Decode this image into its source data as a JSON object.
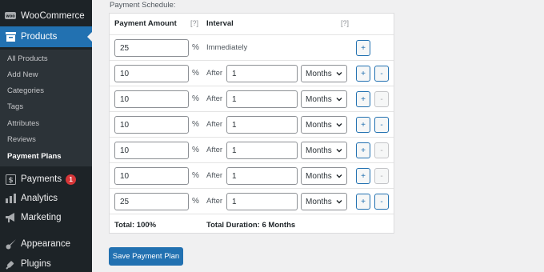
{
  "sidebar": {
    "woocommerce": "WooCommerce",
    "products": "Products",
    "submenu": [
      "All Products",
      "Add New",
      "Categories",
      "Tags",
      "Attributes",
      "Reviews",
      "Payment Plans"
    ],
    "payments": "Payments",
    "payments_badge": "1",
    "analytics": "Analytics",
    "marketing": "Marketing",
    "appearance": "Appearance",
    "plugins": "Plugins"
  },
  "schedule": {
    "caption": "Payment Schedule:",
    "col_amount": "Payment Amount",
    "col_interval": "Interval",
    "help": "[?]",
    "percent": "%",
    "immediately": "Immediately",
    "after": "After",
    "add": "+",
    "remove": "-",
    "rows": [
      {
        "amount": "25"
      },
      {
        "amount": "10",
        "interval": "1",
        "unit": "Months"
      },
      {
        "amount": "10",
        "interval": "1",
        "unit": "Months"
      },
      {
        "amount": "10",
        "interval": "1",
        "unit": "Months"
      },
      {
        "amount": "10",
        "interval": "1",
        "unit": "Months"
      },
      {
        "amount": "10",
        "interval": "1",
        "unit": "Months"
      },
      {
        "amount": "25",
        "interval": "1",
        "unit": "Months"
      }
    ],
    "total": "Total: 100%",
    "duration": "Total Duration: 6 Months"
  },
  "save_button": "Save Payment Plan"
}
